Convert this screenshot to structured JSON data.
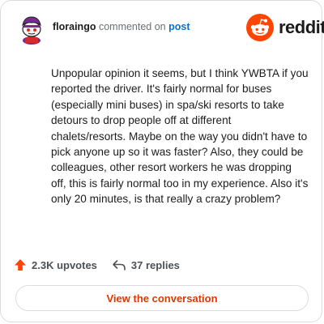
{
  "header": {
    "username": "floraingo",
    "action_text": "commented on",
    "link_text": "post"
  },
  "logo": {
    "icon": "reddit-snoo-icon",
    "wordmark": "reddit",
    "brand_color": "#ff4500"
  },
  "comment": {
    "body": "Unpopular opinion it seems, but I think YWBTA if you reported the driver. It's fairly normal for buses (especially mini buses) in spa/ski resorts to take detours to drop people off at different chalets/resorts. Maybe on the way you didn't have to pick anyone up so it was faster? Also, they could be colleagues, other resort workers he was dropping off, this is fairly normal too in my experience. Also it's only 20 minutes, is that really a crazy problem?"
  },
  "actions": {
    "upvotes": "2.3K upvotes",
    "upvote_icon": "upvote-arrow-icon",
    "upvote_color": "#ff4500",
    "replies": "37 replies",
    "reply_icon": "reply-arrow-icon"
  },
  "cta": {
    "label": "View the conversation",
    "color": "#d93a00"
  }
}
